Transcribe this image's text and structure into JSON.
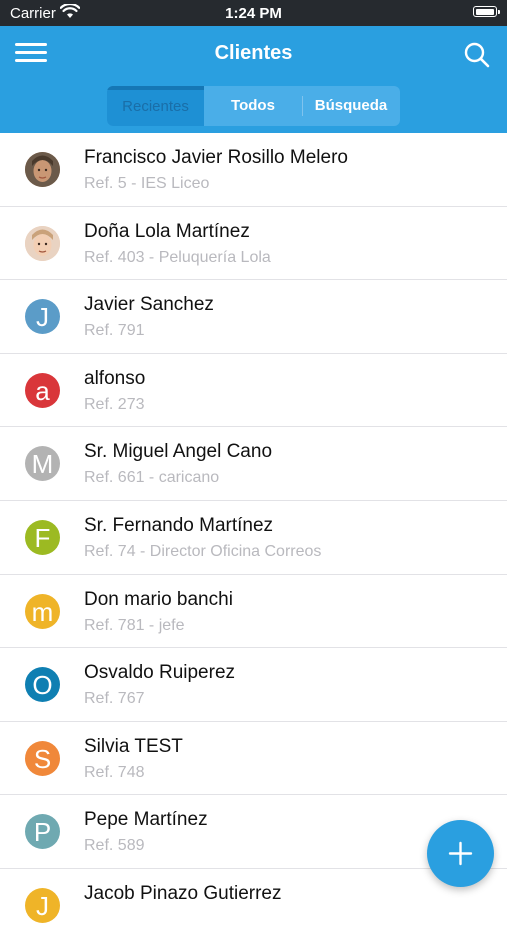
{
  "status_bar": {
    "carrier": "Carrier",
    "time": "1:24 PM"
  },
  "header": {
    "title": "Clientes",
    "menu_icon": "hamburger-menu-icon",
    "search_icon": "search-icon"
  },
  "tabs": [
    {
      "label": "Recientes",
      "active": true
    },
    {
      "label": "Todos",
      "active": false
    },
    {
      "label": "Búsqueda",
      "active": false
    }
  ],
  "clients": [
    {
      "name": "Francisco Javier Rosillo Melero",
      "subtitle": "Ref. 5 - IES Liceo",
      "avatar_type": "photo",
      "initial": "",
      "color": "#b9865e"
    },
    {
      "name": "Doña Lola Martínez",
      "subtitle": "Ref. 403 - Peluquería Lola",
      "avatar_type": "photo",
      "initial": "",
      "color": "#f0c9a9"
    },
    {
      "name": "Javier Sanchez",
      "subtitle": "Ref. 791",
      "avatar_type": "initial",
      "initial": "J",
      "color": "#5b9cc8"
    },
    {
      "name": "alfonso",
      "subtitle": "Ref. 273",
      "avatar_type": "initial",
      "initial": "a",
      "color": "#d9363a"
    },
    {
      "name": "Sr. Miguel Angel Cano",
      "subtitle": "Ref. 661 - caricano",
      "avatar_type": "initial",
      "initial": "M",
      "color": "#b3b3b3"
    },
    {
      "name": "Sr. Fernando Martínez",
      "subtitle": "Ref. 74 - Director Oficina Correos",
      "avatar_type": "initial",
      "initial": "F",
      "color": "#9cba22"
    },
    {
      "name": "Don mario banchi",
      "subtitle": "Ref. 781 - jefe",
      "avatar_type": "initial",
      "initial": "m",
      "color": "#efb428"
    },
    {
      "name": "Osvaldo Ruiperez",
      "subtitle": "Ref. 767",
      "avatar_type": "initial",
      "initial": "O",
      "color": "#0f7fb2"
    },
    {
      "name": "Silvia TEST",
      "subtitle": "Ref. 748",
      "avatar_type": "initial",
      "initial": "S",
      "color": "#f0883a"
    },
    {
      "name": "Pepe Martínez",
      "subtitle": "Ref. 589",
      "avatar_type": "initial",
      "initial": "P",
      "color": "#6fa9b1"
    },
    {
      "name": "Jacob Pinazo Gutierrez",
      "subtitle": "",
      "avatar_type": "initial",
      "initial": "J",
      "color": "#efb428"
    }
  ],
  "fab": {
    "icon": "plus-icon",
    "color": "#2a9fe0"
  },
  "colors": {
    "accent": "#2a9fe0",
    "status_bar": "#262a2f"
  }
}
